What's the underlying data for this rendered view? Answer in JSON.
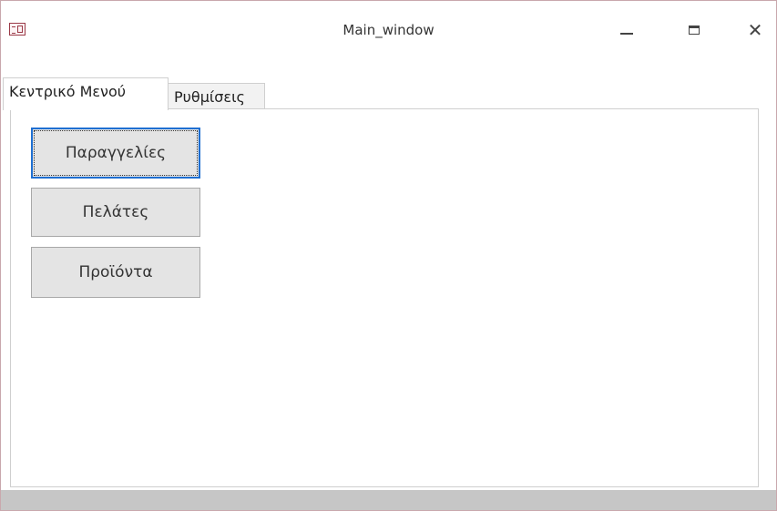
{
  "window": {
    "title": "Main_window",
    "accent_color": "#9b3a48"
  },
  "titlebar_buttons": {
    "minimize_glyph": "—",
    "maximize_glyph": "☐",
    "close_glyph": "✕"
  },
  "tabs": [
    {
      "label": "Κεντρικό Μενού",
      "active": true
    },
    {
      "label": "Ρυθμίσεις",
      "active": false
    }
  ],
  "menu_buttons": [
    {
      "label": "Παραγγελίες",
      "focused": true
    },
    {
      "label": "Πελάτες",
      "focused": false
    },
    {
      "label": "Προϊόντα",
      "focused": false
    }
  ],
  "icons": {
    "app": "form-icon",
    "minimize": "minimize-icon",
    "maximize": "maximize-icon",
    "close": "close-icon"
  }
}
